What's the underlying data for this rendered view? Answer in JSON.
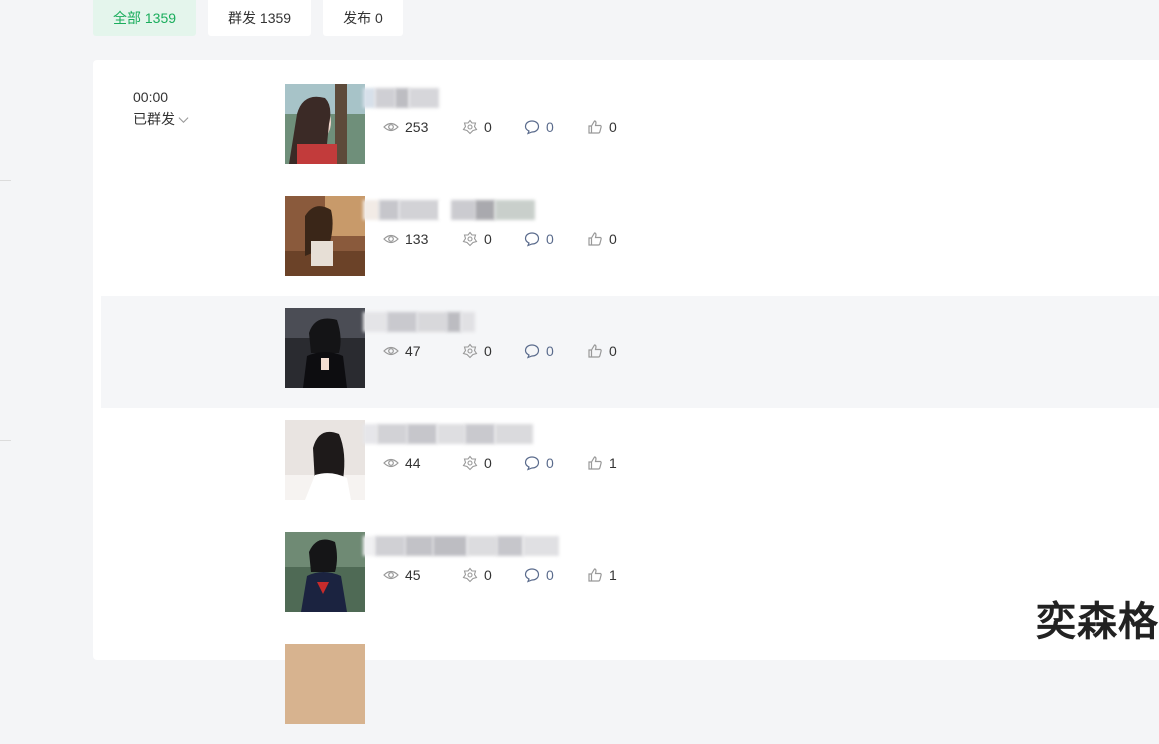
{
  "tabs": [
    {
      "label": "全部 1359",
      "active": true
    },
    {
      "label": "群发 1359",
      "active": false
    },
    {
      "label": "发布 0",
      "active": false
    }
  ],
  "group": {
    "time": "00:00",
    "status": "已群发"
  },
  "posts": [
    {
      "views": "253",
      "shares": "0",
      "comments": "0",
      "likes": "0"
    },
    {
      "views": "133",
      "shares": "0",
      "comments": "0",
      "likes": "0"
    },
    {
      "views": "47",
      "shares": "0",
      "comments": "0",
      "likes": "0"
    },
    {
      "views": "44",
      "shares": "0",
      "comments": "0",
      "likes": "1"
    },
    {
      "views": "45",
      "shares": "0",
      "comments": "0",
      "likes": "1"
    }
  ],
  "icons": {
    "views": "eye-icon",
    "shares": "share-icon",
    "comments": "comment-icon",
    "likes": "thumbs-up-icon",
    "status": "chevron-down-icon"
  },
  "colors": {
    "accent": "#1aad5c",
    "active_tab_bg": "#e4f5ec",
    "comment_count": "#5a6b8c"
  },
  "watermark": "奕森格"
}
